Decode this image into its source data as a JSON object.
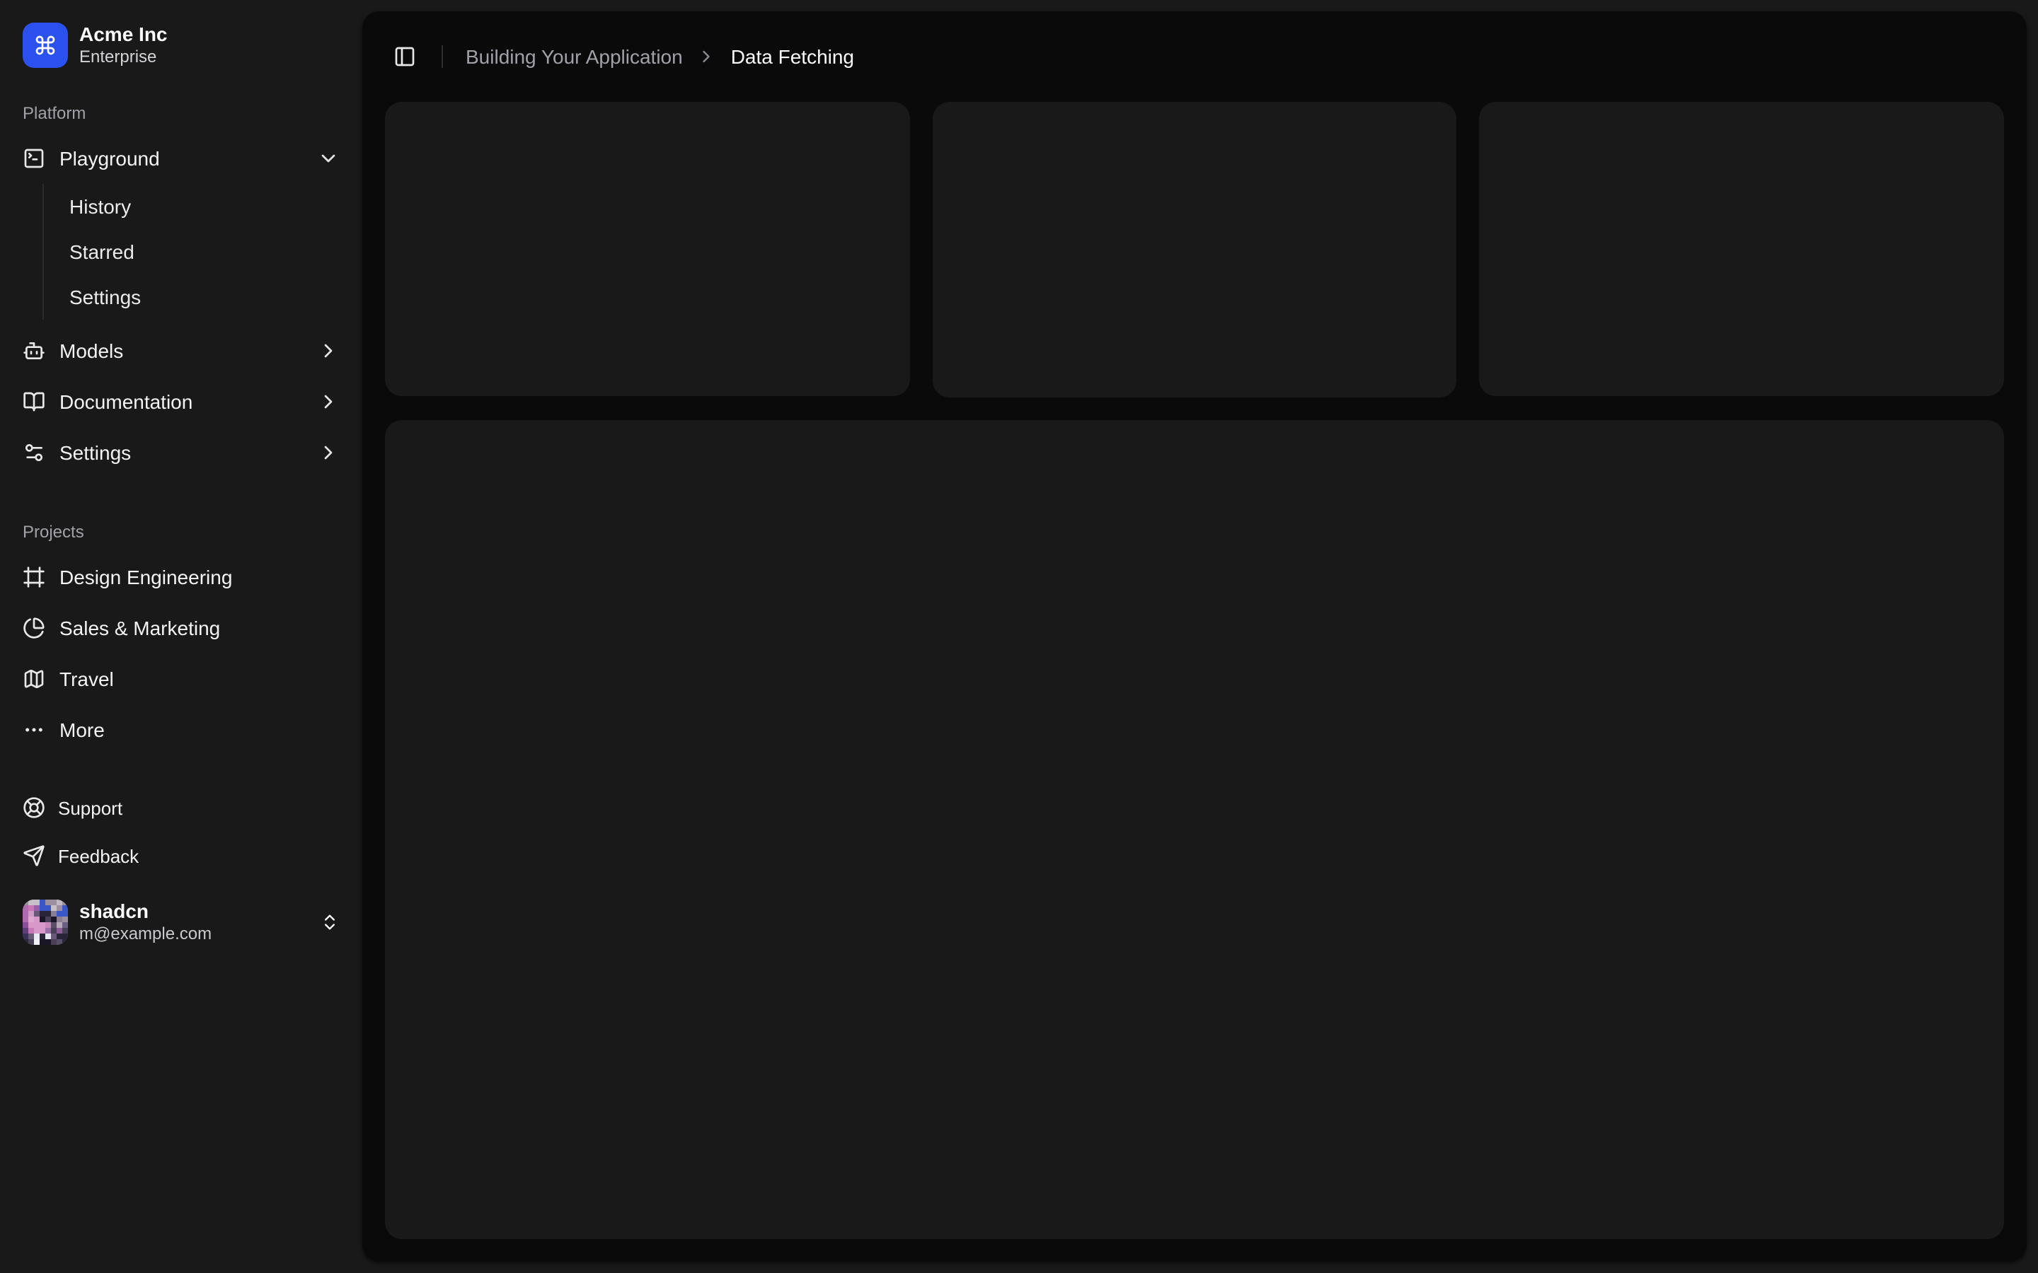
{
  "brand": {
    "name": "Acme Inc",
    "plan": "Enterprise",
    "logo_icon": "command-icon"
  },
  "nav": {
    "platform": {
      "label": "Platform",
      "items": [
        {
          "label": "Playground",
          "icon": "square-terminal-icon",
          "state": "expanded",
          "sub": [
            {
              "label": "History"
            },
            {
              "label": "Starred"
            },
            {
              "label": "Settings"
            }
          ]
        },
        {
          "label": "Models",
          "icon": "bot-icon",
          "state": "collapsed"
        },
        {
          "label": "Documentation",
          "icon": "book-open-icon",
          "state": "collapsed"
        },
        {
          "label": "Settings",
          "icon": "settings-sliders-icon",
          "state": "collapsed"
        }
      ]
    },
    "projects": {
      "label": "Projects",
      "items": [
        {
          "label": "Design Engineering",
          "icon": "frame-icon"
        },
        {
          "label": "Sales & Marketing",
          "icon": "pie-chart-icon"
        },
        {
          "label": "Travel",
          "icon": "map-icon"
        },
        {
          "label": "More",
          "icon": "ellipsis-icon"
        }
      ]
    },
    "secondary": {
      "items": [
        {
          "label": "Support",
          "icon": "life-buoy-icon"
        },
        {
          "label": "Feedback",
          "icon": "send-icon"
        }
      ]
    }
  },
  "user": {
    "name": "shadcn",
    "email": "m@example.com"
  },
  "header": {
    "breadcrumb": {
      "parent": "Building Your Application",
      "current": "Data Fetching"
    },
    "toggle_icon": "panel-left-icon"
  },
  "placeholders": {
    "top_cards": 3,
    "large_cards": 1
  },
  "colors": {
    "accent_blue": "#2b52ee",
    "sidebar_bg": "#191919",
    "panel_bg": "#0a0a0b",
    "card_bg": "rgba(39,39,42,0.5)",
    "text_primary": "#fafafa",
    "text_muted": "#a1a1aa",
    "border": "#2c2c30"
  }
}
